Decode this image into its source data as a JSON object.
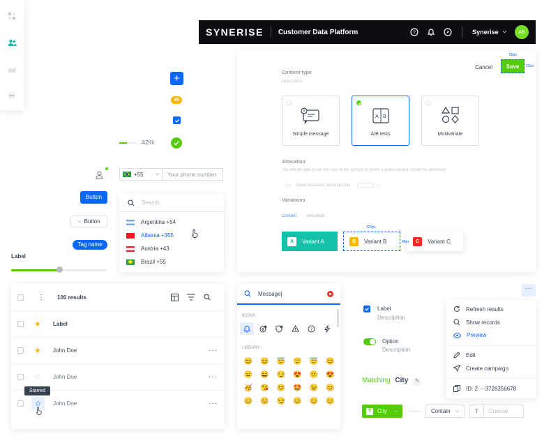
{
  "topbar": {
    "logo": "SYNERISE",
    "app_name": "Customer Data Platform",
    "workspace": "Synerise",
    "avatar_initials": "AB"
  },
  "left_controls": {
    "badge_count": "45",
    "progress_percent": 42,
    "progress_label": "42%",
    "phone": {
      "country_code": "+55",
      "placeholder": "Your phone number"
    },
    "button_label": "Button",
    "dropdown_button_label": "Button",
    "tag_label": "Tag name",
    "slider_label": "Label",
    "slider_value": 0.5
  },
  "country_list": {
    "search_placeholder": "Search",
    "items": [
      {
        "label": "Argentina +54",
        "flag": "argentina",
        "active": false
      },
      {
        "label": "Albania +355",
        "flag": "albania",
        "active": true
      },
      {
        "label": "Austria +43",
        "flag": "austria",
        "active": false
      },
      {
        "label": "Brazil +55",
        "flag": "brazil",
        "active": false
      }
    ]
  },
  "modal": {
    "cancel_label": "Cancel",
    "save_label": "Save",
    "save_width_hint": "55px",
    "save_height_hint": "22px",
    "content_type_title": "Content type",
    "content_type_desc": "Description",
    "content_types": [
      {
        "label": "Simple message",
        "selected": false
      },
      {
        "label": "A/B tests",
        "selected": true
      },
      {
        "label": "Multivariate",
        "selected": false
      }
    ],
    "allocation_title": "Allocation",
    "allocation_desc": "You will be able to set the size of the groups to which a given variant should be delivered",
    "allocation_toggle_label": "Make allocation automatically",
    "variations_title": "Variations",
    "tabs": [
      "Content",
      "Allocation"
    ],
    "variants": [
      {
        "letter": "A",
        "label": "Variant A",
        "color": "#13c2a8"
      },
      {
        "letter": "B",
        "label": "Variant B",
        "color": "#fab700"
      },
      {
        "letter": "C",
        "label": "Variant C",
        "color": "#f52922"
      }
    ],
    "variant_width_hint": "120px",
    "variant_height_hint": "48px"
  },
  "table": {
    "results_label": "100 results",
    "header_label": "Label",
    "rows": [
      {
        "name": "John Doe",
        "starred": true
      },
      {
        "name": "John Doe",
        "starred": false
      },
      {
        "name": "John Doe",
        "starred": false
      }
    ],
    "tooltip": "Starred"
  },
  "icon_picker": {
    "search_value": "Message|",
    "icons_section": "ICONS",
    "library_section": "LIBRARY",
    "icons": [
      "notification-icon",
      "settings-alert-icon",
      "shield-alert-icon",
      "warning-icon",
      "help-icon",
      "bolt-icon"
    ],
    "emojis": [
      "😊",
      "😊",
      "😇",
      "🙂",
      "😇",
      "😊",
      "😐",
      "😄",
      "😏",
      "😍",
      "😕",
      "😍",
      "🥳",
      "😘",
      "😊",
      "🤩",
      "😉",
      "😊",
      "😊",
      "😊",
      "😏",
      "😊",
      "😊",
      "😊"
    ]
  },
  "options": {
    "checkbox_label": "Label",
    "checkbox_desc": "Description",
    "toggle_label": "Option",
    "toggle_desc": "Description",
    "matching_label": "Matching",
    "matching_value": "City",
    "city_chip": "City",
    "operator": "Contain",
    "value_placeholder": "Cracow"
  },
  "context_menu": {
    "items": [
      "Refresh results",
      "Show records",
      "Preview",
      "Edit",
      "Create campaign"
    ],
    "id_label": "ID: 2····3728356678",
    "active_index": 2
  },
  "colors": {
    "primary": "#0b68ff",
    "success": "#54cb0b",
    "dark": "#0b0d10",
    "text": "#384350"
  }
}
